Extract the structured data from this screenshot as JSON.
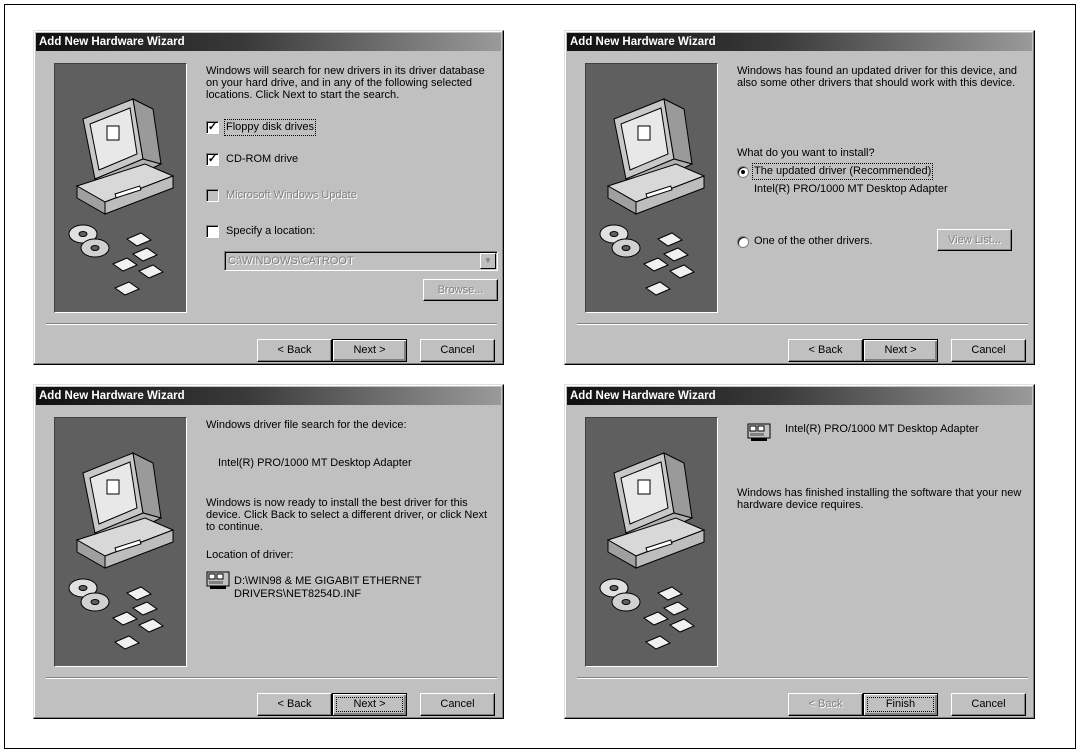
{
  "wizard_title": "Add New Hardware Wizard",
  "buttons": {
    "back": "< Back",
    "next": "Next >",
    "cancel": "Cancel",
    "finish": "Finish"
  },
  "search_step": {
    "intro": "Windows will search for new drivers in its driver database on your hard drive, and in any of the following selected locations. Click Next to start the search.",
    "options": [
      {
        "label": "Floppy disk drives",
        "checked": true,
        "enabled": true
      },
      {
        "label": "CD-ROM drive",
        "checked": true,
        "enabled": true
      },
      {
        "label": "Microsoft Windows Update",
        "checked": false,
        "enabled": false
      },
      {
        "label": "Specify a location:",
        "checked": false,
        "enabled": true
      }
    ],
    "location_value": "C:\\WINDOWS\\CATROOT",
    "browse_label": "Browse..."
  },
  "choose_step": {
    "intro": "Windows has found an updated driver for this device, and also some other drivers that should work with this device.",
    "question": "What do you want to install?",
    "option_updated": "The updated driver (Recommended)",
    "device_name": "Intel(R) PRO/1000 MT Desktop Adapter",
    "option_other": "One of the other drivers.",
    "view_list_label": "View List..."
  },
  "ready_step": {
    "heading": "Windows driver file search for the device:",
    "device_name": "Intel(R) PRO/1000 MT Desktop Adapter",
    "message": "Windows is now ready to install the best driver for this device. Click Back to select a different driver, or click Next to continue.",
    "location_label": "Location of driver:",
    "driver_path_line1": "D:\\WIN98 & ME GIGABIT ETHERNET",
    "driver_path_line2": "DRIVERS\\NET8254D.INF"
  },
  "finish_step": {
    "device_name": "Intel(R) PRO/1000 MT Desktop Adapter",
    "message": "Windows has finished installing the software that your new hardware device requires."
  }
}
